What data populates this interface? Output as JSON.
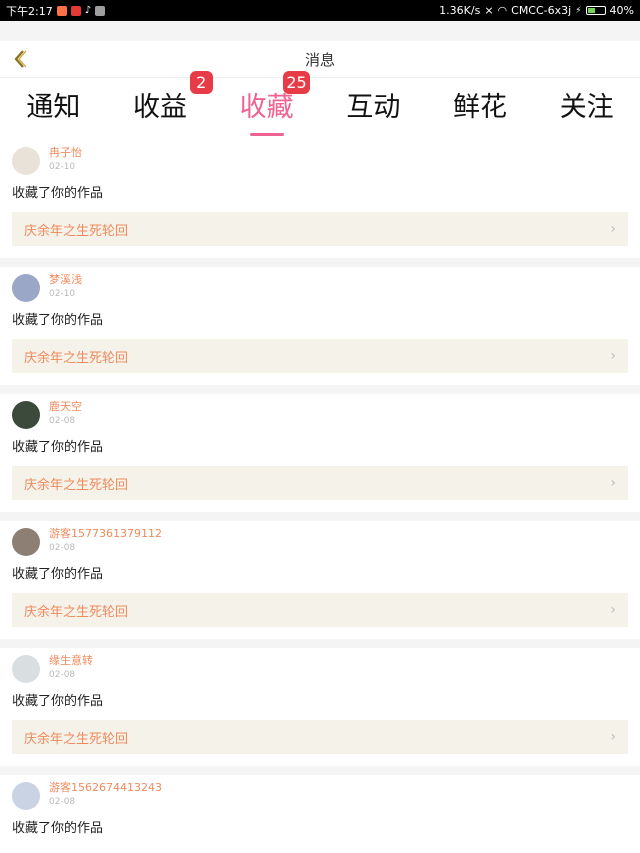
{
  "status_bar": {
    "time": "下午2:17",
    "network_speed": "1.36K/s",
    "carrier": "CMCC-6x3j",
    "battery": "40%"
  },
  "header": {
    "title": "消息"
  },
  "tabs": [
    {
      "label": "通知",
      "badge": "",
      "active": false
    },
    {
      "label": "收益",
      "badge": "2",
      "active": false
    },
    {
      "label": "收藏",
      "badge": "25",
      "active": true
    },
    {
      "label": "互动",
      "badge": "",
      "active": false
    },
    {
      "label": "鲜花",
      "badge": "",
      "active": false
    },
    {
      "label": "关注",
      "badge": "",
      "active": false
    }
  ],
  "feed": [
    {
      "user": "冉子怡",
      "date": "02-10",
      "action": "收藏了你的作品",
      "work": "庆余年之生死轮回",
      "avatar_color": "#e8e2d8"
    },
    {
      "user": "梦溪浅",
      "date": "02-10",
      "action": "收藏了你的作品",
      "work": "庆余年之生死轮回",
      "avatar_color": "#9aa7c6"
    },
    {
      "user": "鹿天空",
      "date": "02-08",
      "action": "收藏了你的作品",
      "work": "庆余年之生死轮回",
      "avatar_color": "#3b4a3a"
    },
    {
      "user": "游客1577361379112",
      "date": "02-08",
      "action": "收藏了你的作品",
      "work": "庆余年之生死轮回",
      "avatar_color": "#8d7f74"
    },
    {
      "user": "缘生意转",
      "date": "02-08",
      "action": "收藏了你的作品",
      "work": "庆余年之生死轮回",
      "avatar_color": "#d9dfe0"
    },
    {
      "user": "游客1562674413243",
      "date": "02-08",
      "action": "收藏了你的作品",
      "work": "",
      "avatar_color": "#c9d3e3"
    }
  ]
}
